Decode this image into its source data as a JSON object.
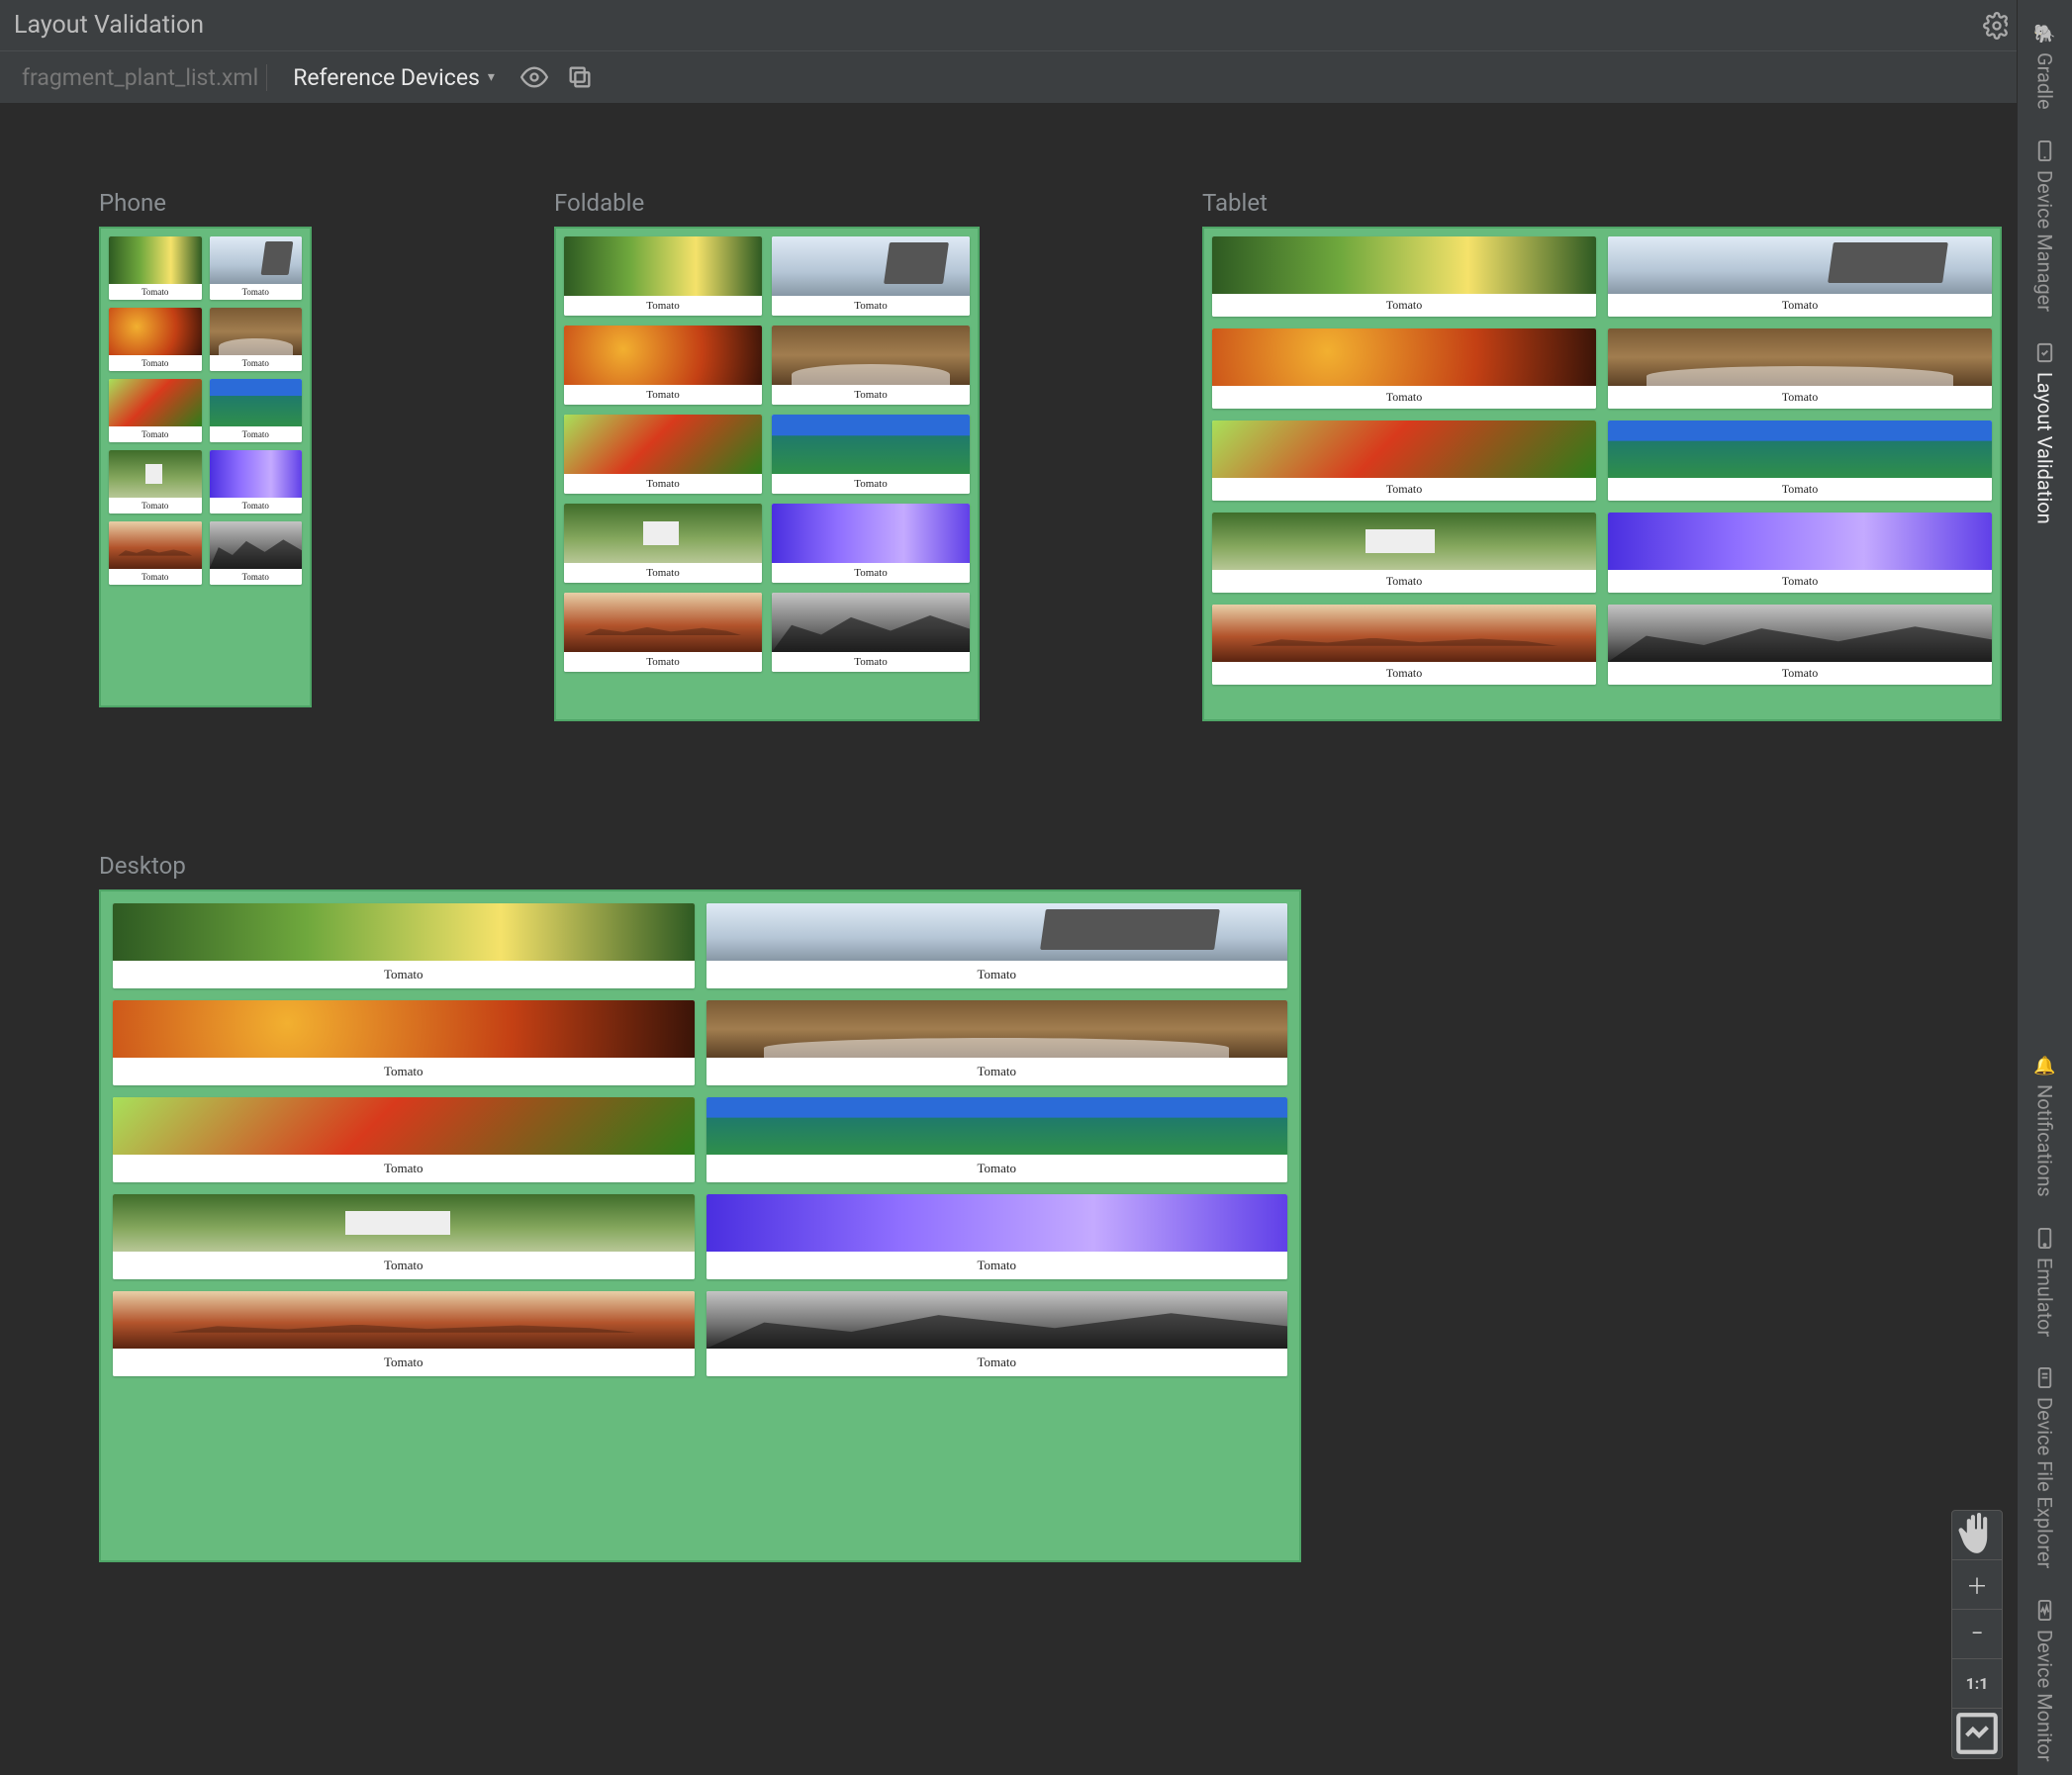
{
  "header": {
    "title": "Layout Validation"
  },
  "toolbar": {
    "tab_name": "fragment_plant_list.xml",
    "reference_devices_label": "Reference Devices"
  },
  "devices": {
    "phone": {
      "label": "Phone"
    },
    "foldable": {
      "label": "Foldable"
    },
    "tablet": {
      "label": "Tablet"
    },
    "desktop": {
      "label": "Desktop"
    }
  },
  "card_label": "Tomato",
  "zoom": {
    "one_to_one": "1:1"
  },
  "right_rail": {
    "items": [
      {
        "label": "Gradle"
      },
      {
        "label": "Device Manager"
      },
      {
        "label": "Layout Validation",
        "active": true
      },
      {
        "label": "Notifications"
      },
      {
        "label": "Emulator"
      },
      {
        "label": "Device File Explorer"
      },
      {
        "label": "Device Monitor"
      }
    ]
  },
  "colors": {
    "frame_green": "#67bb7d",
    "bg": "#2b2b2b",
    "panel": "#3c3f41"
  }
}
